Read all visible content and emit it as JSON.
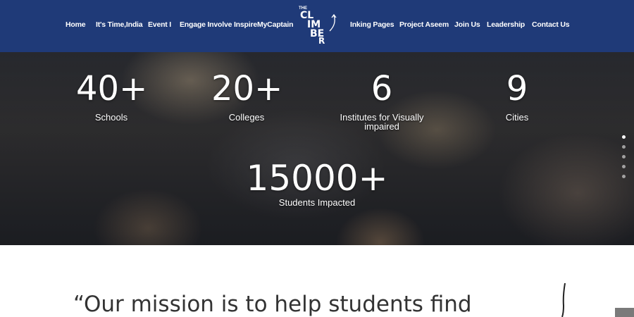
{
  "nav": {
    "items": [
      "Home",
      "It's Time,India",
      "Event I",
      "Engage Involve Inspire",
      "MyCaptain",
      "Inking Pages",
      "Project Aseem",
      "Join Us",
      "Leadership",
      "Contact Us"
    ],
    "logo_text": [
      "THE",
      "CL",
      "IM",
      "BE",
      "R"
    ]
  },
  "hero": {
    "stats": [
      {
        "number": "40+",
        "label": "Schools"
      },
      {
        "number": "20+",
        "label": "Colleges"
      },
      {
        "number": "6",
        "label_line1": "Institutes for Visually",
        "label_line2": "impaired"
      },
      {
        "number": "9",
        "label": "Cities"
      }
    ],
    "highlight": {
      "number": "15000+",
      "label": "Students Impacted"
    },
    "slide_count": 5,
    "active_slide": 1
  },
  "mission": {
    "quote": "“Our mission is to help students find"
  },
  "colors": {
    "header": "#1f3a78",
    "text": "#333333"
  }
}
